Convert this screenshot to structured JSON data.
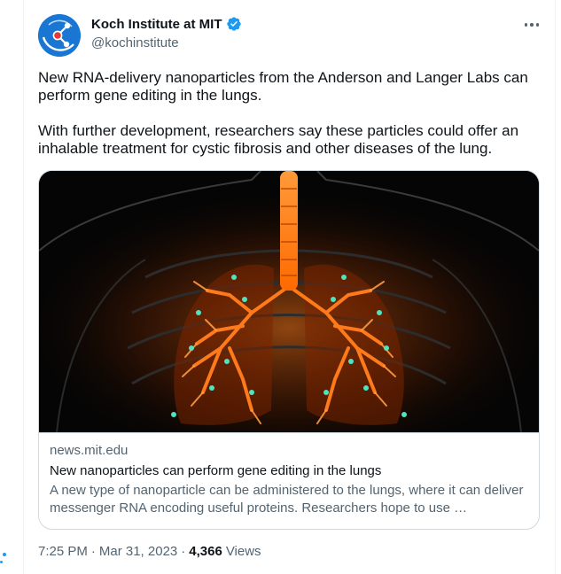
{
  "author": {
    "display_name": "Koch Institute at MIT",
    "handle": "@kochinstitute",
    "avatar_icon": "koch-institute-logo-icon",
    "verified_icon": "verified-badge-icon",
    "brand_color": "#1976d2"
  },
  "tweet": {
    "paragraph_1": "New RNA-delivery nanoparticles from the Anderson and Langer Labs can perform gene editing in the lungs.",
    "paragraph_2": "With further development, researchers say these particles could offer an inhalable treatment for cystic fibrosis and other diseases of the lung."
  },
  "card": {
    "image_icon": "lungs-illustration",
    "domain": "news.mit.edu",
    "title": "New nanoparticles can perform gene editing in the lungs",
    "description": "A new type of nanoparticle can be administered to the lungs, where it can deliver messenger RNA encoding useful proteins. Researchers hope to use …"
  },
  "meta": {
    "time": "7:25 PM",
    "separator": "·",
    "date": "Mar 31, 2023",
    "views_count": "4,366",
    "views_label": "Views"
  },
  "colors": {
    "accent": "#1d9bf0",
    "text_primary": "#0f1419",
    "text_secondary": "#536471",
    "border": "#cfd9de"
  }
}
